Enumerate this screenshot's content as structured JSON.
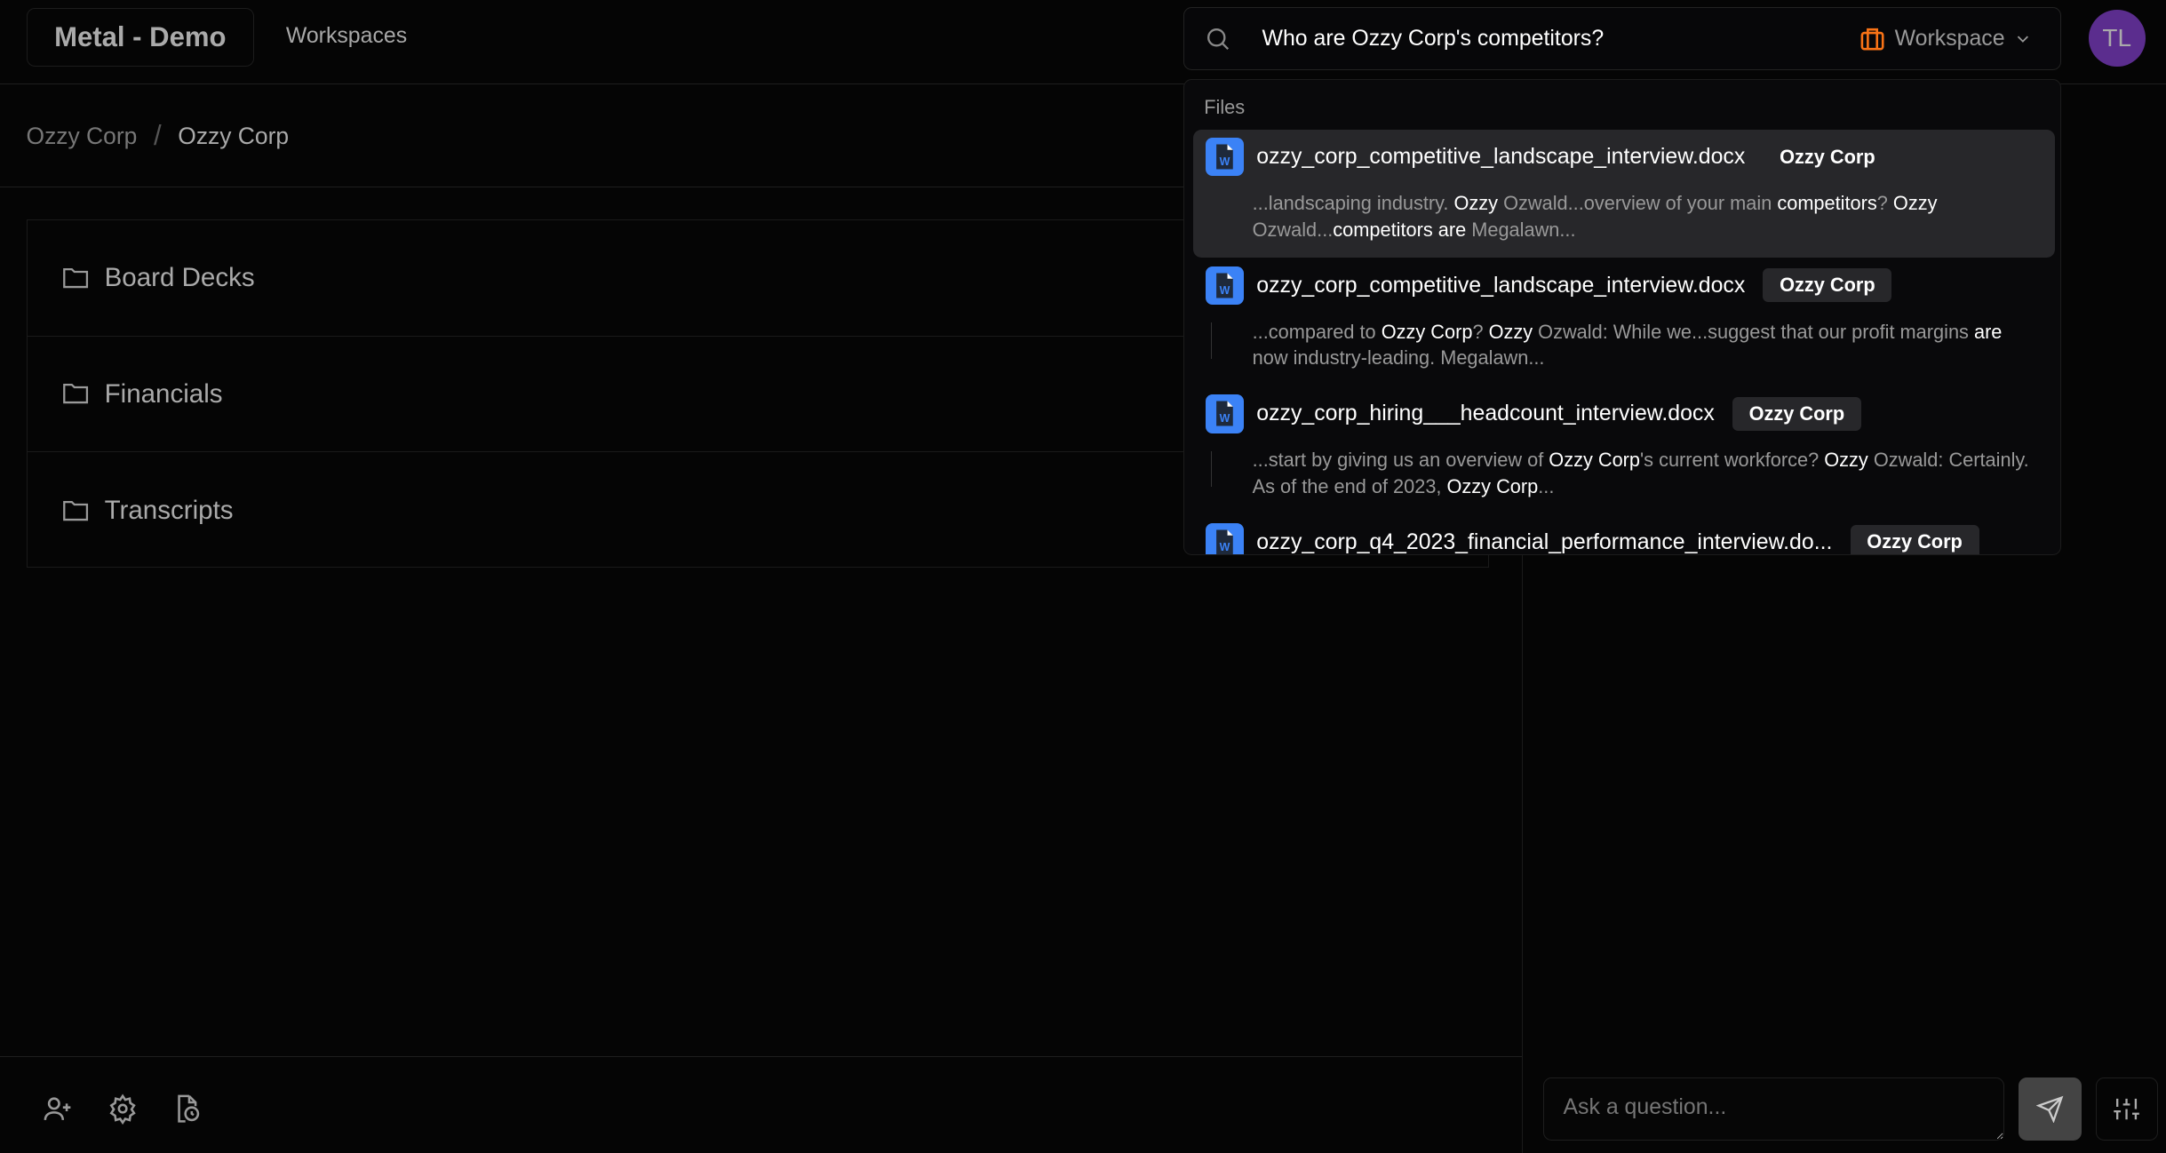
{
  "header": {
    "logo": "Metal - Demo",
    "workspaces": "Workspaces",
    "avatar": "TL"
  },
  "breadcrumb": [
    "Ozzy Corp",
    "Ozzy Corp"
  ],
  "folders": [
    "Board Decks",
    "Financials",
    "Transcripts"
  ],
  "search": {
    "query": "Who are Ozzy Corp's competitors?",
    "scope": "Workspace",
    "scope_color": "#f97316"
  },
  "results": {
    "section": "Files",
    "items": [
      {
        "file": "ozzy_corp_competitive_landscape_interview.docx",
        "badge": "Ozzy Corp",
        "selected": true,
        "snippet": [
          {
            "t": "...landscaping industry. ",
            "h": false
          },
          {
            "t": "Ozzy",
            "h": true
          },
          {
            "t": " Ozwald...overview of your main ",
            "h": false
          },
          {
            "t": "competitors",
            "h": true
          },
          {
            "t": "? ",
            "h": false
          },
          {
            "t": "Ozzy",
            "h": true
          },
          {
            "t": " Ozwald...",
            "h": false
          },
          {
            "t": "competitors are",
            "h": true
          },
          {
            "t": " Megalawn...",
            "h": false
          }
        ]
      },
      {
        "file": "ozzy_corp_competitive_landscape_interview.docx",
        "badge": "Ozzy Corp",
        "selected": false,
        "snippet": [
          {
            "t": "...compared to ",
            "h": false
          },
          {
            "t": "Ozzy Corp",
            "h": true
          },
          {
            "t": "? ",
            "h": false
          },
          {
            "t": "Ozzy",
            "h": true
          },
          {
            "t": " Ozwald: While we...suggest that our profit margins ",
            "h": false
          },
          {
            "t": "are",
            "h": true
          },
          {
            "t": " now industry-leading. Megalawn...",
            "h": false
          }
        ]
      },
      {
        "file": "ozzy_corp_hiring___headcount_interview.docx",
        "badge": "Ozzy Corp",
        "selected": false,
        "snippet": [
          {
            "t": "...start by giving us an overview of ",
            "h": false
          },
          {
            "t": "Ozzy Corp",
            "h": true
          },
          {
            "t": "'s current workforce? ",
            "h": false
          },
          {
            "t": "Ozzy",
            "h": true
          },
          {
            "t": " Ozwald: Certainly. As of the end of 2023, ",
            "h": false
          },
          {
            "t": "Ozzy Corp",
            "h": true
          },
          {
            "t": "...",
            "h": false
          }
        ]
      },
      {
        "file": "ozzy_corp_q4_2023_financial_performance_interview.do...",
        "badge": "Ozzy Corp",
        "selected": false,
        "snippet": []
      }
    ]
  },
  "chat": {
    "placeholder": "Ask a question..."
  }
}
